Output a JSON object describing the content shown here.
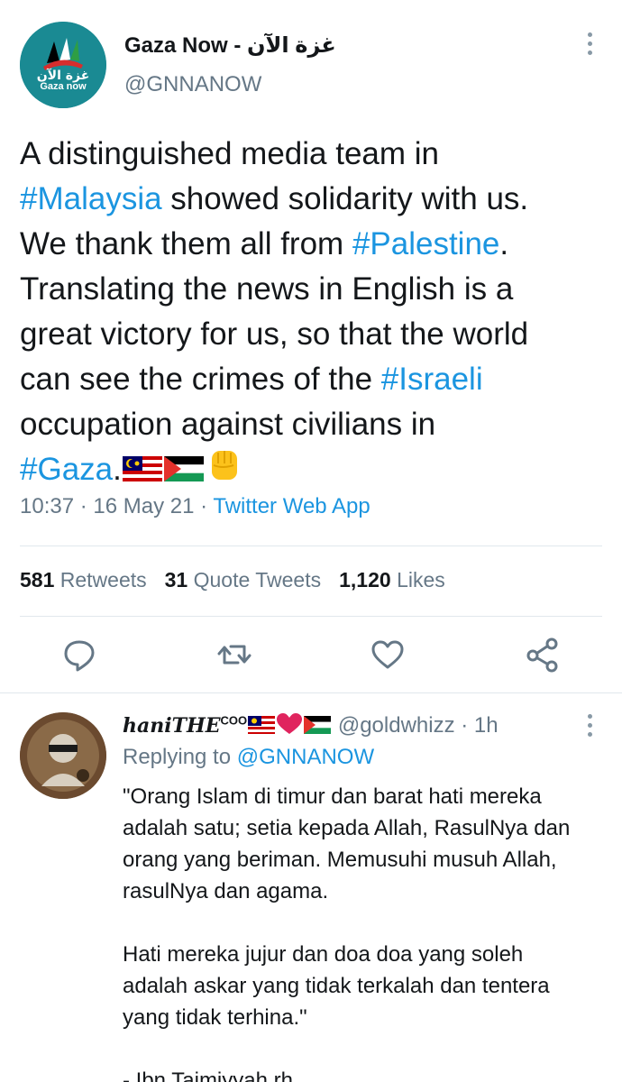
{
  "tweet": {
    "author_name": "Gaza Now - غزة الآن",
    "author_handle": "@GNNANOW",
    "avatar_label": "Gaza now",
    "text": {
      "p1": "A distinguished media team in",
      "tag_malaysia": "#Malaysia",
      "p2": " showed solidarity with us.",
      "p3": "We thank them all from ",
      "tag_palestine": "#Palestine",
      "p4": ".",
      "p5": "Translating the news in English is a",
      "p6": "great victory for us, so that the world",
      "p7": "can see the crimes of the ",
      "tag_israeli": "#Israeli",
      "p8": "occupation against civilians in",
      "tag_gaza": "#Gaza",
      "p9": "."
    },
    "time": "10:37",
    "date": "16 May 21",
    "app": "Twitter Web App",
    "stats": {
      "retweets_count": "581",
      "retweets_label": "Retweets",
      "quotes_count": "31",
      "quotes_label": "Quote Tweets",
      "likes_count": "1,120",
      "likes_label": "Likes"
    },
    "action_icons": [
      "reply-icon",
      "retweet-icon",
      "like-icon",
      "share-icon"
    ],
    "accent_color": "#1b95e0"
  },
  "reply": {
    "name": "haniTHE",
    "name_sup": "COO",
    "handle": "@goldwhizz",
    "time": "1h",
    "replying_prefix": "Replying to ",
    "replying_to": "@GNNANOW",
    "lines": [
      "\"Orang Islam di timur dan barat hati mereka",
      "adalah satu; setia kepada Allah, RasulNya dan",
      "orang yang beriman. Memusuhi musuh Allah,",
      "rasulNya dan agama.",
      "",
      "Hati mereka jujur dan doa doa yang soleh",
      "adalah askar yang tidak terkalah dan tentera",
      "yang tidak terhina.\"",
      "",
      "- Ibn Taimiyyah rh"
    ]
  }
}
